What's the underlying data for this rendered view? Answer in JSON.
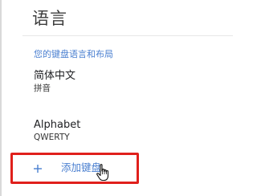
{
  "page": {
    "title": "语言"
  },
  "section": {
    "header": "您的键盘语言和布局"
  },
  "keyboards": [
    {
      "name": "简体中文",
      "layout": "拼音"
    },
    {
      "name": "Alphabet",
      "layout": "QWERTY"
    }
  ],
  "actions": {
    "add_keyboard_label": "添加键盘",
    "plus_icon": "plus-icon"
  },
  "colors": {
    "accent": "#4a7fd0",
    "highlight": "#e0201c",
    "text": "#202124"
  }
}
